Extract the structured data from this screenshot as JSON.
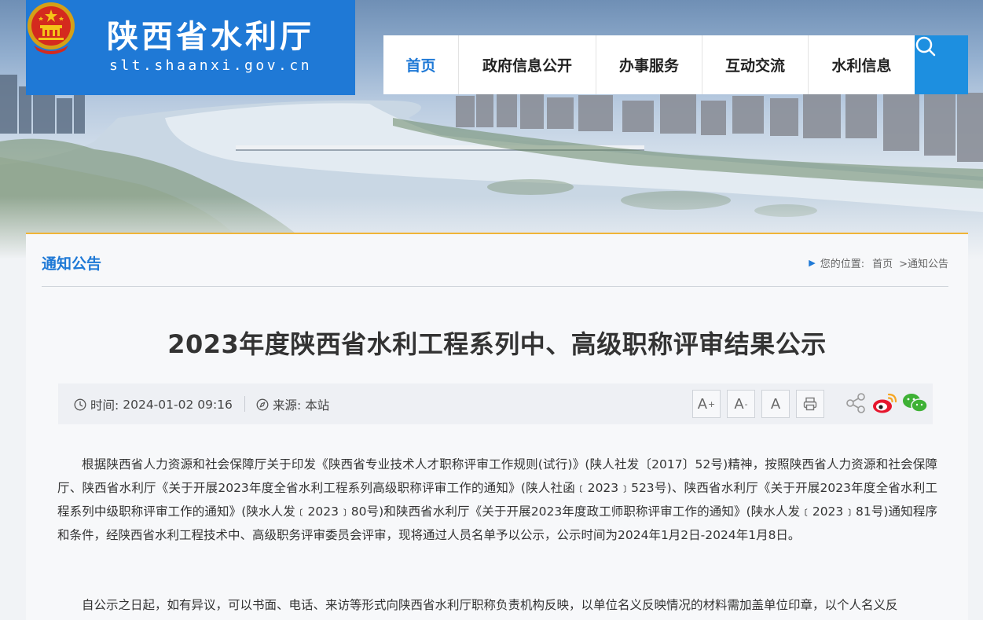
{
  "header": {
    "site_name": "陕西省水利厅",
    "site_url": "slt.shaanxi.gov.cn"
  },
  "nav": {
    "items": [
      {
        "label": "首页",
        "active": true
      },
      {
        "label": "政府信息公开",
        "active": false
      },
      {
        "label": "办事服务",
        "active": false
      },
      {
        "label": "互动交流",
        "active": false
      },
      {
        "label": "水利信息",
        "active": false
      }
    ],
    "search_icon": "search-icon"
  },
  "section": {
    "title": "通知公告",
    "breadcrumb_prefix": "您的位置:",
    "breadcrumb_home": "首页",
    "breadcrumb_current": ">通知公告"
  },
  "article": {
    "title": "2023年度陕西省水利工程系列中、高级职称评审结果公示",
    "time_label": "时间:",
    "time_value": "2024-01-02 09:16",
    "source_label": "来源:",
    "source_value": "本站",
    "tools": {
      "font_large": "A",
      "font_large_sup": "+",
      "font_small": "A",
      "font_small_sup": "-",
      "font_reset": "A"
    },
    "paragraphs": [
      "根据陕西省人力资源和社会保障厅关于印发《陕西省专业技术人才职称评审工作规则(试行)》(陕人社发〔2017〕52号)精神，按照陕西省人力资源和社会保障厅、陕西省水利厅《关于开展2023年度全省水利工程系列高级职称评审工作的通知》(陕人社函﹝2023﹞523号)、陕西省水利厅《关于开展2023年度全省水利工程系列中级职称评审工作的通知》(陕水人发﹝2023﹞80号)和陕西省水利厅《关于开展2023年度政工师职称评审工作的通知》(陕水人发﹝2023﹞81号)通知程序和条件，经陕西省水利工程技术中、高级职务评审委员会评审，现将通过人员名单予以公示，公示时间为2024年1月2日-2024年1月8日。",
      "自公示之日起，如有异议，可以书面、电话、来访等形式向陕西省水利厅职称负责机构反映，以单位名义反映情况的材料需加盖单位印章，以个人名义反"
    ]
  },
  "colors": {
    "brand_blue": "#1f79d6",
    "accent_gold": "#f0b437",
    "search_blue": "#1d8fe0"
  }
}
